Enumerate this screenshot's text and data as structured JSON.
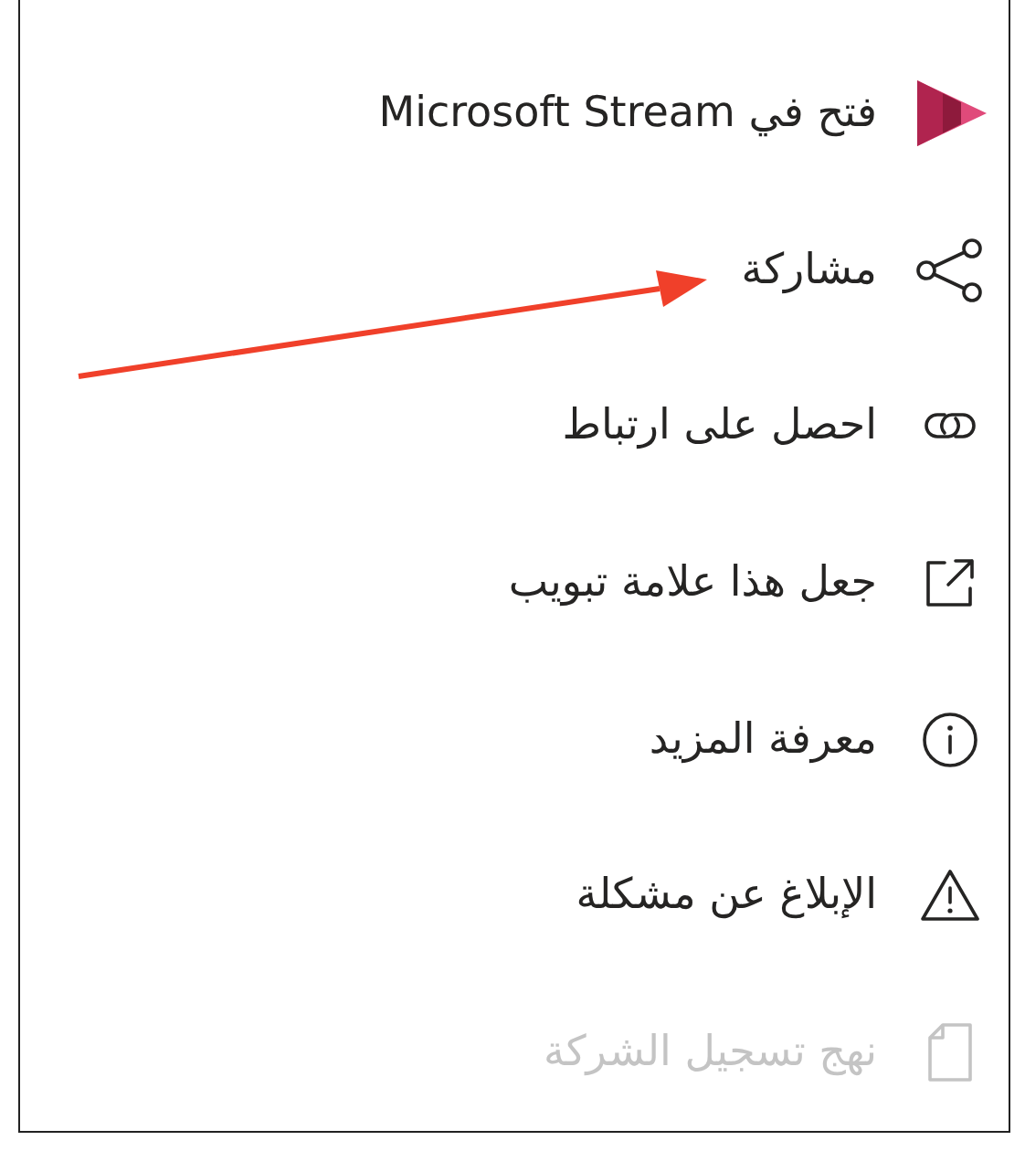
{
  "menu": {
    "items": [
      {
        "kind": "stream",
        "label": "فتح في Microsoft Stream",
        "disabled": false
      },
      {
        "kind": "share",
        "label": "مشاركة",
        "disabled": false
      },
      {
        "kind": "link",
        "label": "احصل على ارتباط",
        "disabled": false
      },
      {
        "kind": "tab",
        "label": "جعل هذا علامة تبويب",
        "disabled": false
      },
      {
        "kind": "info",
        "label": "معرفة المزيد",
        "disabled": false
      },
      {
        "kind": "warning",
        "label": "الإبلاغ عن مشكلة",
        "disabled": false
      },
      {
        "kind": "policy",
        "label": "نهج تسجيل الشركة",
        "disabled": true
      }
    ]
  }
}
